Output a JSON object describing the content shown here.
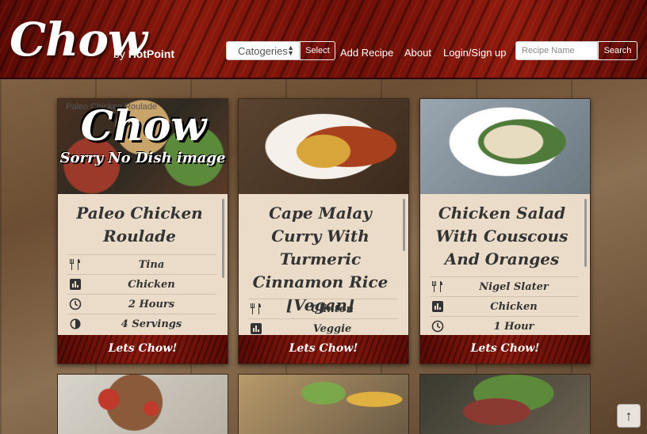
{
  "header": {
    "logo": "Chow",
    "by": "by",
    "brand": "HotPoint",
    "categories_placeholder": "Catogeries",
    "select_label": "Select",
    "nav": [
      "Add Recipe",
      "About",
      "Login/Sign up"
    ],
    "search_placeholder": "Recipe Name",
    "search_label": "Search"
  },
  "cards": [
    {
      "title": "Paleo Chicken Roulade",
      "image_alt": "Paleo Chicken Roulade",
      "placeholder_logo": "Chow",
      "placeholder_text": "Sorry No Dish image",
      "author": "Tina",
      "category": "Chicken",
      "time": "2 Hours",
      "servings": "4 Servings",
      "button": "Lets Chow!"
    },
    {
      "title": "Cape Malay Curry With Turmeric Cinnamon Rice [Vegan]",
      "author": "Clinton",
      "category": "Veggie",
      "button": "Lets Chow!"
    },
    {
      "title": "Chicken Salad With Couscous And Oranges",
      "author": "Nigel Slater",
      "category": "Chicken",
      "time": "1 Hour",
      "button": "Lets Chow!"
    }
  ],
  "icons": [
    "cutlery-icon",
    "category-icon",
    "clock-icon",
    "servings-icon",
    "arrow-up-icon"
  ],
  "colors": {
    "header_red": "#8b1a0e",
    "card_bg": "#eadcc8"
  }
}
